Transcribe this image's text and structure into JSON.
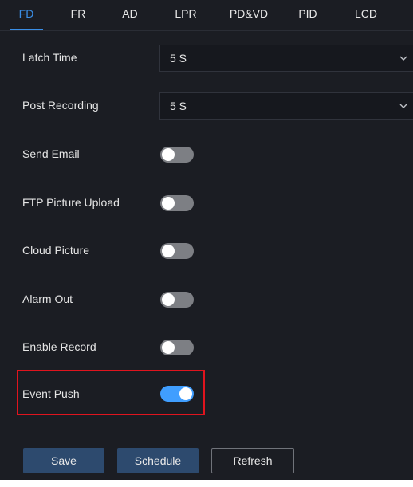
{
  "tabs": [
    {
      "label": "FD",
      "active": true
    },
    {
      "label": "FR"
    },
    {
      "label": "AD"
    },
    {
      "label": "LPR"
    },
    {
      "label": "PD&VD"
    },
    {
      "label": "PID"
    },
    {
      "label": "LCD"
    }
  ],
  "settings": {
    "latch_time": {
      "label": "Latch Time",
      "value": "5 S"
    },
    "post_recording": {
      "label": "Post Recording",
      "value": "5 S"
    },
    "send_email": {
      "label": "Send Email",
      "on": false
    },
    "ftp_picture_upload": {
      "label": "FTP Picture Upload",
      "on": false
    },
    "cloud_picture": {
      "label": "Cloud Picture",
      "on": false
    },
    "alarm_out": {
      "label": "Alarm Out",
      "on": false
    },
    "enable_record": {
      "label": "Enable Record",
      "on": false
    },
    "event_push": {
      "label": "Event Push",
      "on": true
    }
  },
  "buttons": {
    "save": "Save",
    "schedule": "Schedule",
    "refresh": "Refresh"
  },
  "colors": {
    "accent": "#409eff",
    "highlight": "#e0141e",
    "background": "#1b1d23"
  },
  "icons": {
    "select_chevron": "chevron-down-icon"
  }
}
